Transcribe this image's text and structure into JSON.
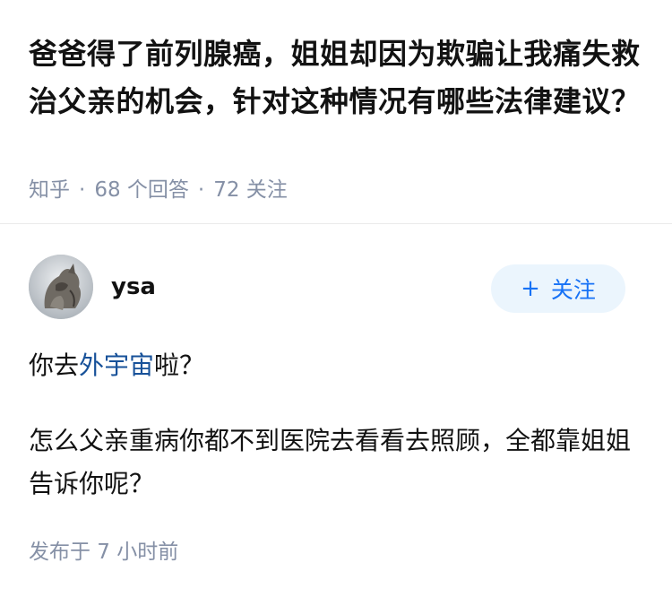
{
  "question": {
    "title": "爸爸得了前列腺癌，姐姐却因为欺骗让我痛失救治父亲的机会，针对这种情况有哪些法律建议？",
    "source": "知乎",
    "separator": "·",
    "answer_count": "68 个回答",
    "follow_count": "72 关注"
  },
  "answer": {
    "author": {
      "name": "ysa"
    },
    "follow_button": {
      "plus": "+",
      "label": "关注"
    },
    "paragraph1": {
      "before": "你去",
      "link": "外宇宙",
      "after": "啦？"
    },
    "paragraph2": "怎么父亲重病你都不到医院去看看去照顾，全都靠姐姐告诉你呢？",
    "publish_time": "发布于  7 小时前"
  },
  "colors": {
    "accent": "#1772f6",
    "link": "#175199",
    "meta": "#8590a6",
    "follow_bg": "#ebf5fd"
  }
}
